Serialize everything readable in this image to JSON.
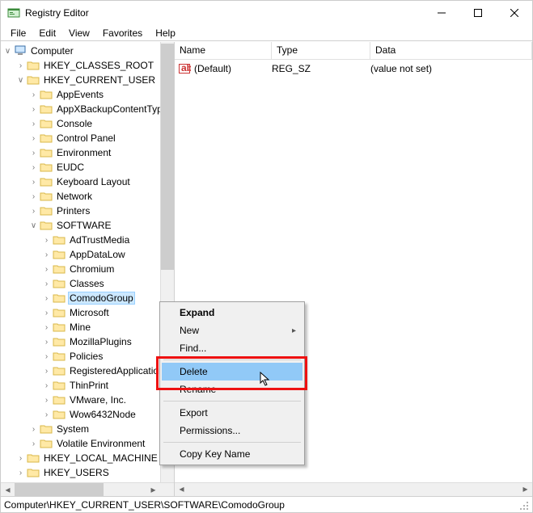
{
  "window": {
    "title": "Registry Editor"
  },
  "menu": {
    "file": "File",
    "edit": "Edit",
    "view": "View",
    "favorites": "Favorites",
    "help": "Help"
  },
  "tree": {
    "root": "Computer",
    "hives": {
      "hkcr": "HKEY_CLASSES_ROOT",
      "hkcu": "HKEY_CURRENT_USER",
      "hklm": "HKEY_LOCAL_MACHINE",
      "hku": "HKEY_USERS"
    },
    "hkcu_children": {
      "appevents": "AppEvents",
      "appxbackup": "AppXBackupContentType",
      "console": "Console",
      "controlpanel": "Control Panel",
      "environment": "Environment",
      "eudc": "EUDC",
      "keyboard": "Keyboard Layout",
      "network": "Network",
      "printers": "Printers",
      "software": "SOFTWARE",
      "system": "System",
      "volatile": "Volatile Environment"
    },
    "software_children": {
      "adtrust": "AdTrustMedia",
      "appdatalow": "AppDataLow",
      "chromium": "Chromium",
      "classes": "Classes",
      "comodo": "ComodoGroup",
      "microsoft": "Microsoft",
      "mine": "Mine",
      "mozilla": "MozillaPlugins",
      "policies": "Policies",
      "registered": "RegisteredApplications",
      "thinprint": "ThinPrint",
      "vmware": "VMware, Inc.",
      "wow64": "Wow6432Node"
    }
  },
  "list": {
    "headers": {
      "name": "Name",
      "type": "Type",
      "data": "Data"
    },
    "rows": [
      {
        "name": "(Default)",
        "type": "REG_SZ",
        "data": "(value not set)"
      }
    ]
  },
  "context_menu": {
    "expand": "Expand",
    "new": "New",
    "find": "Find...",
    "delete": "Delete",
    "rename": "Rename",
    "export": "Export",
    "permissions": "Permissions...",
    "copy_key": "Copy Key Name"
  },
  "status": {
    "path": "Computer\\HKEY_CURRENT_USER\\SOFTWARE\\ComodoGroup"
  }
}
